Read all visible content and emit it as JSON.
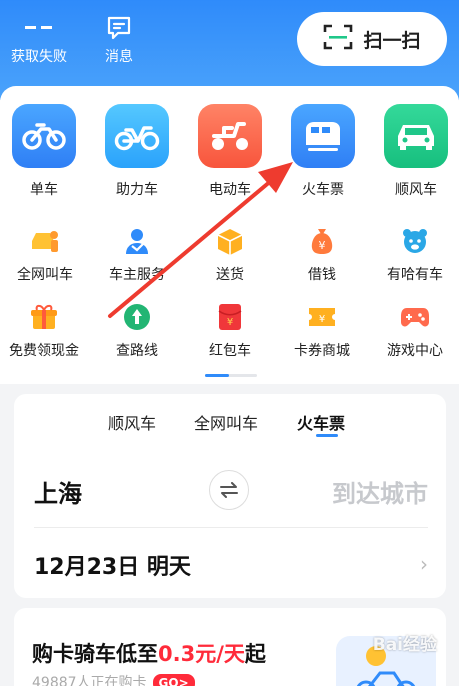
{
  "header": {
    "location_label": "获取失败",
    "messages_label": "消息",
    "scan_label": "扫一扫"
  },
  "primary_services": [
    {
      "label": "单车",
      "icon": "bicycle-icon",
      "color": "#2f8bfa"
    },
    {
      "label": "助力车",
      "icon": "ebike-icon",
      "color": "#2faaff"
    },
    {
      "label": "电动车",
      "icon": "scooter-icon",
      "color": "#ff6a4d"
    },
    {
      "label": "火车票",
      "icon": "train-icon",
      "color": "#2f8bfa"
    },
    {
      "label": "顺风车",
      "icon": "car-icon",
      "color": "#1fc789"
    }
  ],
  "secondary_services": [
    {
      "label": "全网叫车",
      "icon": "taxi-call-icon"
    },
    {
      "label": "车主服务",
      "icon": "car-owner-icon"
    },
    {
      "label": "送货",
      "icon": "delivery-box-icon"
    },
    {
      "label": "借钱",
      "icon": "money-bag-icon"
    },
    {
      "label": "有哈有车",
      "icon": "bear-icon"
    },
    {
      "label": "免费领现金",
      "icon": "gift-icon"
    },
    {
      "label": "查路线",
      "icon": "route-icon"
    },
    {
      "label": "红包车",
      "icon": "red-envelope-icon"
    },
    {
      "label": "卡券商城",
      "icon": "coupon-icon"
    },
    {
      "label": "游戏中心",
      "icon": "gamepad-icon"
    }
  ],
  "ticket": {
    "tabs": [
      "顺风车",
      "全网叫车",
      "火车票"
    ],
    "active_tab": "火车票",
    "from_city": "上海",
    "to_city_placeholder": "到达城市",
    "date_text": "12月23日 明天"
  },
  "promo": {
    "title_prefix": "购卡骑车低至",
    "title_price": "0.3元/天",
    "title_suffix": "起",
    "subtitle": "49887人正在购卡",
    "go_label": "GO>"
  },
  "watermark": "Bai经验",
  "colors": {
    "accent": "#2f8bfa",
    "promo_red": "#ff2b3a",
    "annotation_arrow": "#ee3b2f"
  }
}
